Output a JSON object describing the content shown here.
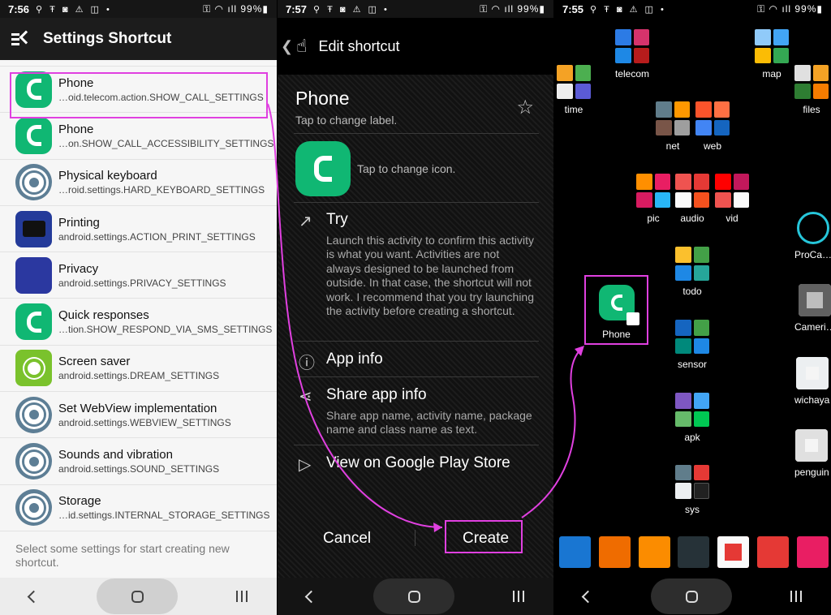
{
  "panel1": {
    "status": {
      "time": "7:56",
      "icons": "⚲ Ŧ ◙ ⚠ ◫ •",
      "right": "⚿ ◠ ıll 99%▮"
    },
    "header": {
      "title": "Settings Shortcut"
    },
    "items": [
      {
        "label": "Phone",
        "sub": "…oid.telecom.action.SHOW_CALL_SETTINGS",
        "icon": "phone-icon"
      },
      {
        "label": "Phone",
        "sub": "…on.SHOW_CALL_ACCESSIBILITY_SETTINGS",
        "icon": "phone-icon"
      },
      {
        "label": "Physical keyboard",
        "sub": "…roid.settings.HARD_KEYBOARD_SETTINGS",
        "icon": "gear-icon"
      },
      {
        "label": "Printing",
        "sub": "android.settings.ACTION_PRINT_SETTINGS",
        "icon": "printer-icon"
      },
      {
        "label": "Privacy",
        "sub": "android.settings.PRIVACY_SETTINGS",
        "icon": "privacy-icon"
      },
      {
        "label": "Quick responses",
        "sub": "…tion.SHOW_RESPOND_VIA_SMS_SETTINGS",
        "icon": "phone-icon"
      },
      {
        "label": "Screen saver",
        "sub": "android.settings.DREAM_SETTINGS",
        "icon": "sun-icon"
      },
      {
        "label": "Set WebView implementation",
        "sub": "android.settings.WEBVIEW_SETTINGS",
        "icon": "gear-icon"
      },
      {
        "label": "Sounds and vibration",
        "sub": "android.settings.SOUND_SETTINGS",
        "icon": "gear-icon"
      },
      {
        "label": "Storage",
        "sub": "…id.settings.INTERNAL_STORAGE_SETTINGS",
        "icon": "gear-icon"
      }
    ],
    "footer": "Select some settings for start creating new shortcut."
  },
  "panel2": {
    "status": {
      "time": "7:57",
      "icons": "⚲ Ŧ ◙ ⚠ ◫ •",
      "right": "⚿ ◠ ıll 99%▮"
    },
    "header": {
      "title": "Edit shortcut",
      "back": "❮",
      "touch": "☝"
    },
    "name": "Phone",
    "tap_label": "Tap to change label.",
    "tap_icon": "Tap to change icon.",
    "star": "☆",
    "try": {
      "title": "Try",
      "icon": "↗",
      "desc": "Launch this activity to confirm this activity is what you want. Activities are not always designed to be launched from outside. In that case, the shortcut will not work. I recommend that you try launching the activity before creating a shortcut."
    },
    "app_info": {
      "title": "App info",
      "icon": "ⓘ"
    },
    "share": {
      "title": "Share app info",
      "icon": "⋖",
      "desc": "Share app name, activity name, package name and class name as text."
    },
    "play": {
      "title": "View on Google Play Store",
      "icon": "▷"
    },
    "cancel": "Cancel",
    "create": "Create"
  },
  "panel3": {
    "status": {
      "time": "7:55",
      "icons": "⚲ Ŧ ◙ ⚠ ◫ •",
      "right": "⚿ ◠ ıll 99%▮"
    },
    "folders": {
      "time": "time",
      "telecom": "telecom",
      "map": "map",
      "files": "files",
      "net": "net",
      "web": "web",
      "pic": "pic",
      "audio": "audio",
      "vid": "vid",
      "todo": "todo",
      "sensor": "sensor",
      "apk": "apk",
      "sys": "sys"
    },
    "apps": {
      "procam": "ProCa…",
      "camera": "Cameri…",
      "wichaya": "wichaya",
      "penguin": "penguin"
    },
    "new_shortcut": "Phone"
  },
  "colors": {
    "highlight": "#e040e0",
    "phone_green": "#10b773"
  }
}
